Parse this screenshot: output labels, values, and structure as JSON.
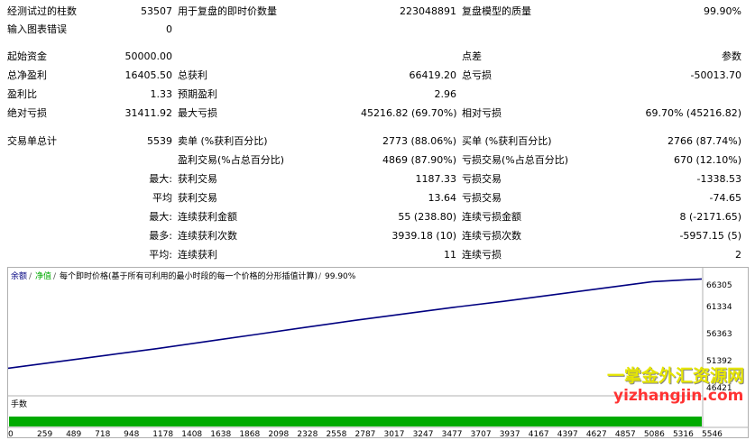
{
  "stats": [
    {
      "label": "经测试过的柱数",
      "value": "53507"
    },
    {
      "label": "用于复盘的即时价数量",
      "value": "223048891"
    },
    {
      "label": "复盘模型的质量",
      "value": "99.90%"
    },
    {
      "label": "输入图表错误",
      "value": "0"
    },
    {
      "label": "起始资金",
      "value": "50000.00"
    },
    {
      "label": "点差",
      "value": "参数"
    },
    {
      "label": "总净盈利",
      "value": "16405.50"
    },
    {
      "label": "总获利",
      "value": "66419.20"
    },
    {
      "label": "总亏损",
      "value": "-50013.70"
    },
    {
      "label": "盈利比",
      "value": "1.33"
    },
    {
      "label": "预期盈利",
      "value": "2.96"
    },
    {
      "label": "绝对亏损",
      "value": "31411.92"
    },
    {
      "label": "最大亏损",
      "value": "45216.82 (69.70%)"
    },
    {
      "label": "相对亏损",
      "value": "69.70% (45216.82)"
    },
    {
      "label": "交易单总计",
      "value": "5539"
    },
    {
      "label": "卖单 (%获利百分比)",
      "value": "2773 (88.06%)"
    },
    {
      "label": "买单 (%获利百分比)",
      "value": "2766 (87.74%)"
    },
    {
      "label": "盈利交易(%占总百分比)",
      "value": "4869 (87.90%)"
    },
    {
      "label": "亏损交易(%占总百分比)",
      "value": "670 (12.10%)"
    },
    {
      "prefix": "最大:",
      "label": "获利交易",
      "value": "1187.33"
    },
    {
      "label": "亏损交易",
      "value": "-1338.53"
    },
    {
      "prefix": "平均",
      "label": "获利交易",
      "value": "13.64"
    },
    {
      "label": "亏损交易",
      "value": "-74.65"
    },
    {
      "prefix": "最大:",
      "label": "连续获利金额",
      "value": "55 (238.80)"
    },
    {
      "label": "连续亏损金额",
      "value": "8 (-2171.65)"
    },
    {
      "prefix": "最多:",
      "label": "连续获利次数",
      "value": "3939.18 (10)"
    },
    {
      "label": "连续亏损次数",
      "value": "-5957.15 (5)"
    },
    {
      "prefix": "平均:",
      "label": "连续获利",
      "value": "11"
    },
    {
      "label": "连续亏损",
      "value": "2"
    }
  ],
  "chart": {
    "legend_balance": "余额",
    "legend_equity": "净值",
    "legend_sep": "/",
    "legend_model": "每个即时价格(基于所有可利用的最小时段的每一个价格的分形插值计算)",
    "legend_quality": "99.90%",
    "volume_label": "手数",
    "colors": {
      "line": "#000080",
      "volume": "#00aa00",
      "border": "#b0b0b0"
    }
  },
  "chart_data": {
    "type": "line",
    "series": [
      {
        "values": [
          50000,
          51200,
          52400,
          53600,
          54900,
          56200,
          57500,
          58800,
          60000,
          61200,
          62300,
          63500,
          64700,
          65900,
          66405
        ]
      }
    ],
    "y_ticks": [
      "66305",
      "61334",
      "56363",
      "51392",
      "46421"
    ],
    "x_ticks": [
      "0",
      "259",
      "489",
      "718",
      "948",
      "1178",
      "1408",
      "1638",
      "1868",
      "2098",
      "2328",
      "2558",
      "2787",
      "3017",
      "3247",
      "3477",
      "3707",
      "3937",
      "4167",
      "4397",
      "4627",
      "4857",
      "5086",
      "5316",
      "5546"
    ],
    "ylim": [
      46421,
      66305
    ]
  },
  "watermark": {
    "line1": "一掌金外汇资源网",
    "line2": "yizhangjin.com"
  }
}
